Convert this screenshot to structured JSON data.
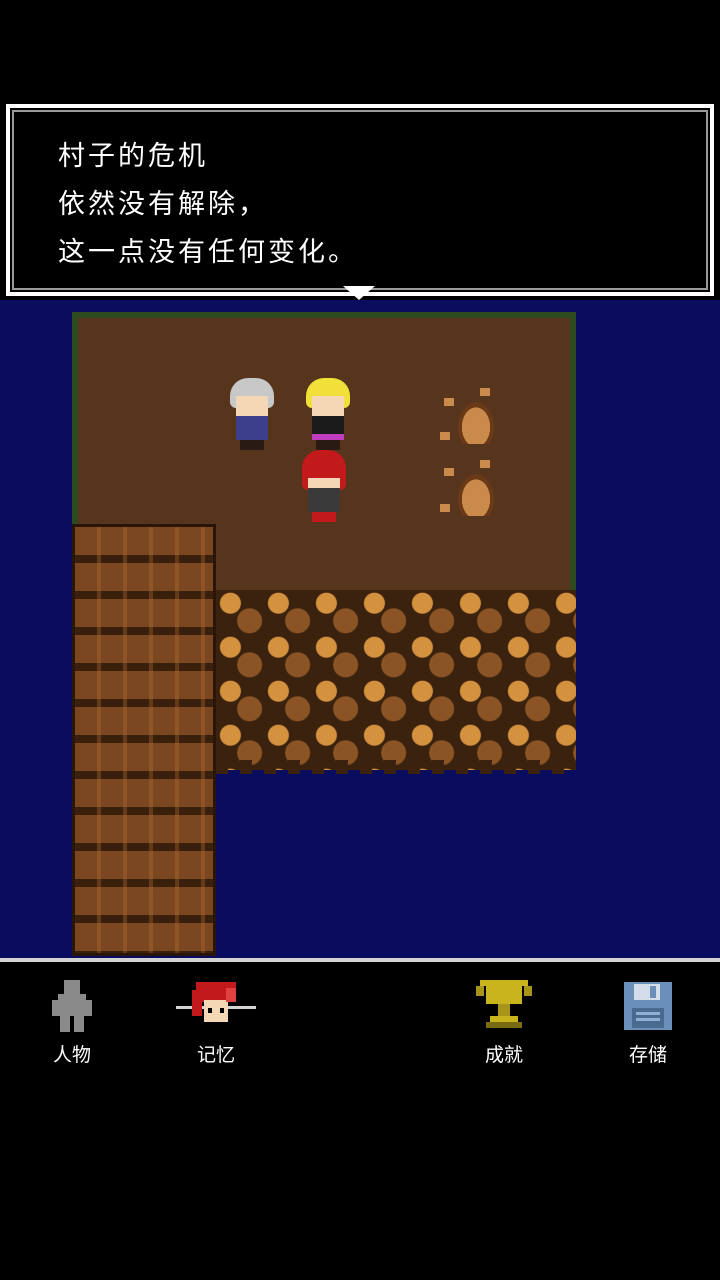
{
  "dialog": {
    "lines": [
      "村子的危机",
      "依然没有解除，",
      "这一点没有任何变化。"
    ]
  },
  "menu": {
    "items": [
      {
        "label": "人物",
        "icon": "person-silhouette-icon"
      },
      {
        "label": "记忆",
        "icon": "red-haired-face-icon"
      },
      {
        "label": "成就",
        "icon": "trophy-icon"
      },
      {
        "label": "存储",
        "icon": "floppy-disk-icon"
      }
    ]
  },
  "colors": {
    "water": "#0a0d5e",
    "ground": "#57341c",
    "dialog_border": "#ffffff",
    "trophy": "#c9b41e",
    "floppy": "#6a8fb8"
  }
}
